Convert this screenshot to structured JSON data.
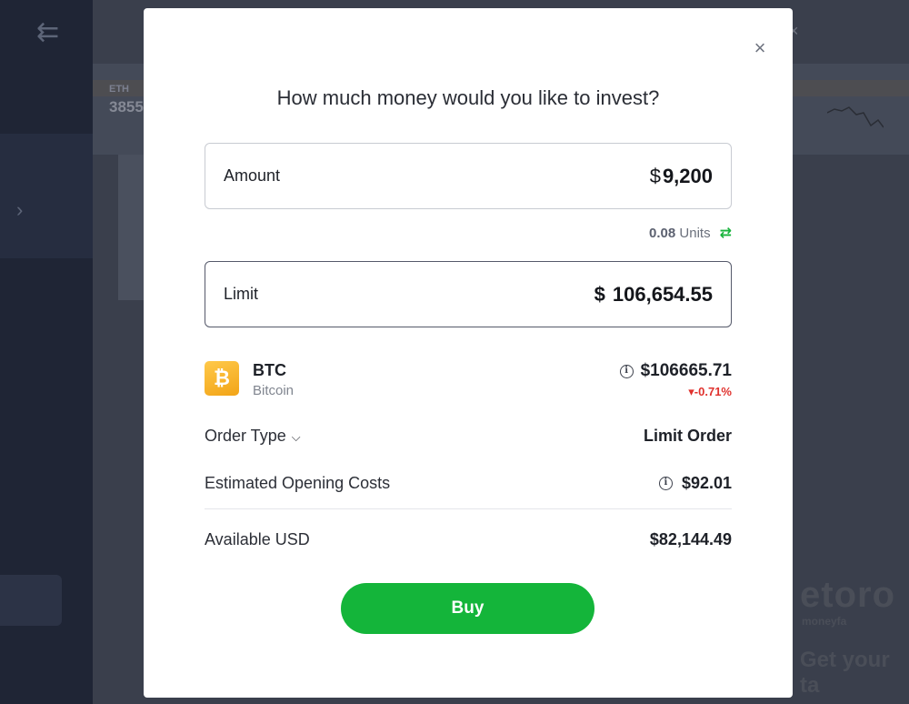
{
  "modal": {
    "title": "How much money would you like to invest?",
    "amount": {
      "label": "Amount",
      "currency": "$",
      "value": "9,200"
    },
    "units": {
      "value": "0.08",
      "label": "Units"
    },
    "limit": {
      "label": "Limit",
      "currency": "$",
      "value": "106,654.55"
    },
    "asset": {
      "symbol": "BTC",
      "name": "Bitcoin",
      "price": "$106665.71",
      "change": "-0.71%",
      "change_color": "#e0322e",
      "logo_color": "#f7b21e"
    },
    "order_type": {
      "label": "Order Type",
      "value": "Limit Order"
    },
    "opening_costs": {
      "label": "Estimated Opening Costs",
      "value": "$92.01"
    },
    "available": {
      "label": "Available USD",
      "value": "$82,144.49"
    },
    "buy_label": "Buy",
    "buy_color": "#14b53a"
  },
  "background": {
    "ticker": "ETH",
    "ticker_value": "3855",
    "brand": "etoro",
    "brand_sub": "moneyfa",
    "heading": "Get your ta"
  },
  "icons": {
    "close": "close-icon",
    "swap": "swap-icon",
    "info": "info-icon",
    "chevron": "chevron-down-icon",
    "bitcoin": "bitcoin-icon",
    "back": "back-arrow-icon"
  }
}
